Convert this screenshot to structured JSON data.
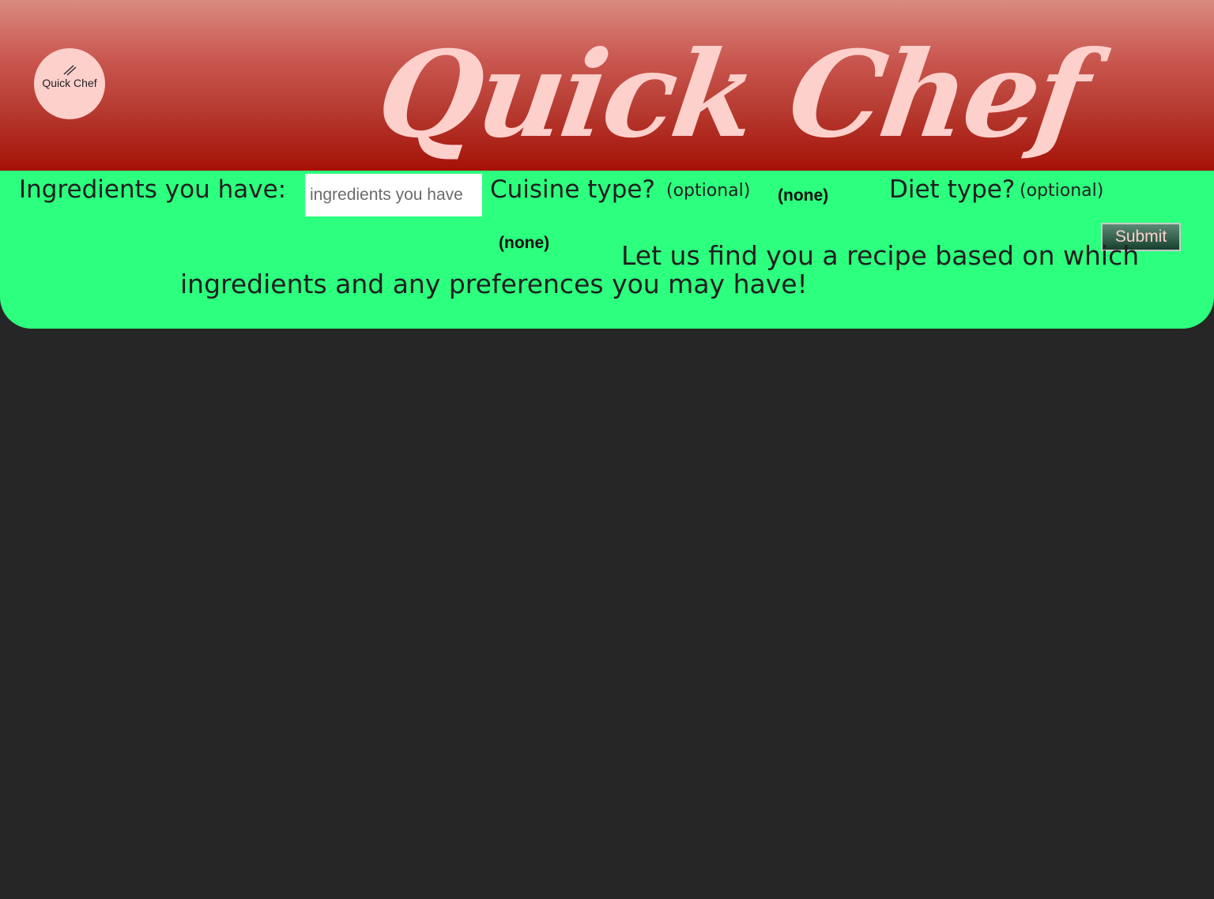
{
  "header": {
    "logo_text": "Quick Chef",
    "logo_icon": "chopsticks-icon",
    "title": "Quick Chef"
  },
  "form": {
    "ingredients_label": "Ingredients you have:",
    "ingredients_placeholder": "ingredients you have",
    "ingredients_value": "",
    "cuisine_label": "Cuisine type?",
    "cuisine_optional": "(optional)",
    "cuisine_selected": "(none)",
    "diet_label": "Diet type?",
    "diet_optional": "(optional)",
    "diet_selected": "(none)",
    "submit_label": "Submit"
  },
  "tagline": "Let us find you a recipe based on which ingredients and any preferences you may have!",
  "colors": {
    "background": "#262626",
    "header_top": "#d98a80",
    "header_bottom": "#a51106",
    "title": "#fdd0cc",
    "form_panel": "#2dff7e",
    "submit_gradient_top": "#5c8a76",
    "submit_gradient_bottom": "#17402e"
  }
}
